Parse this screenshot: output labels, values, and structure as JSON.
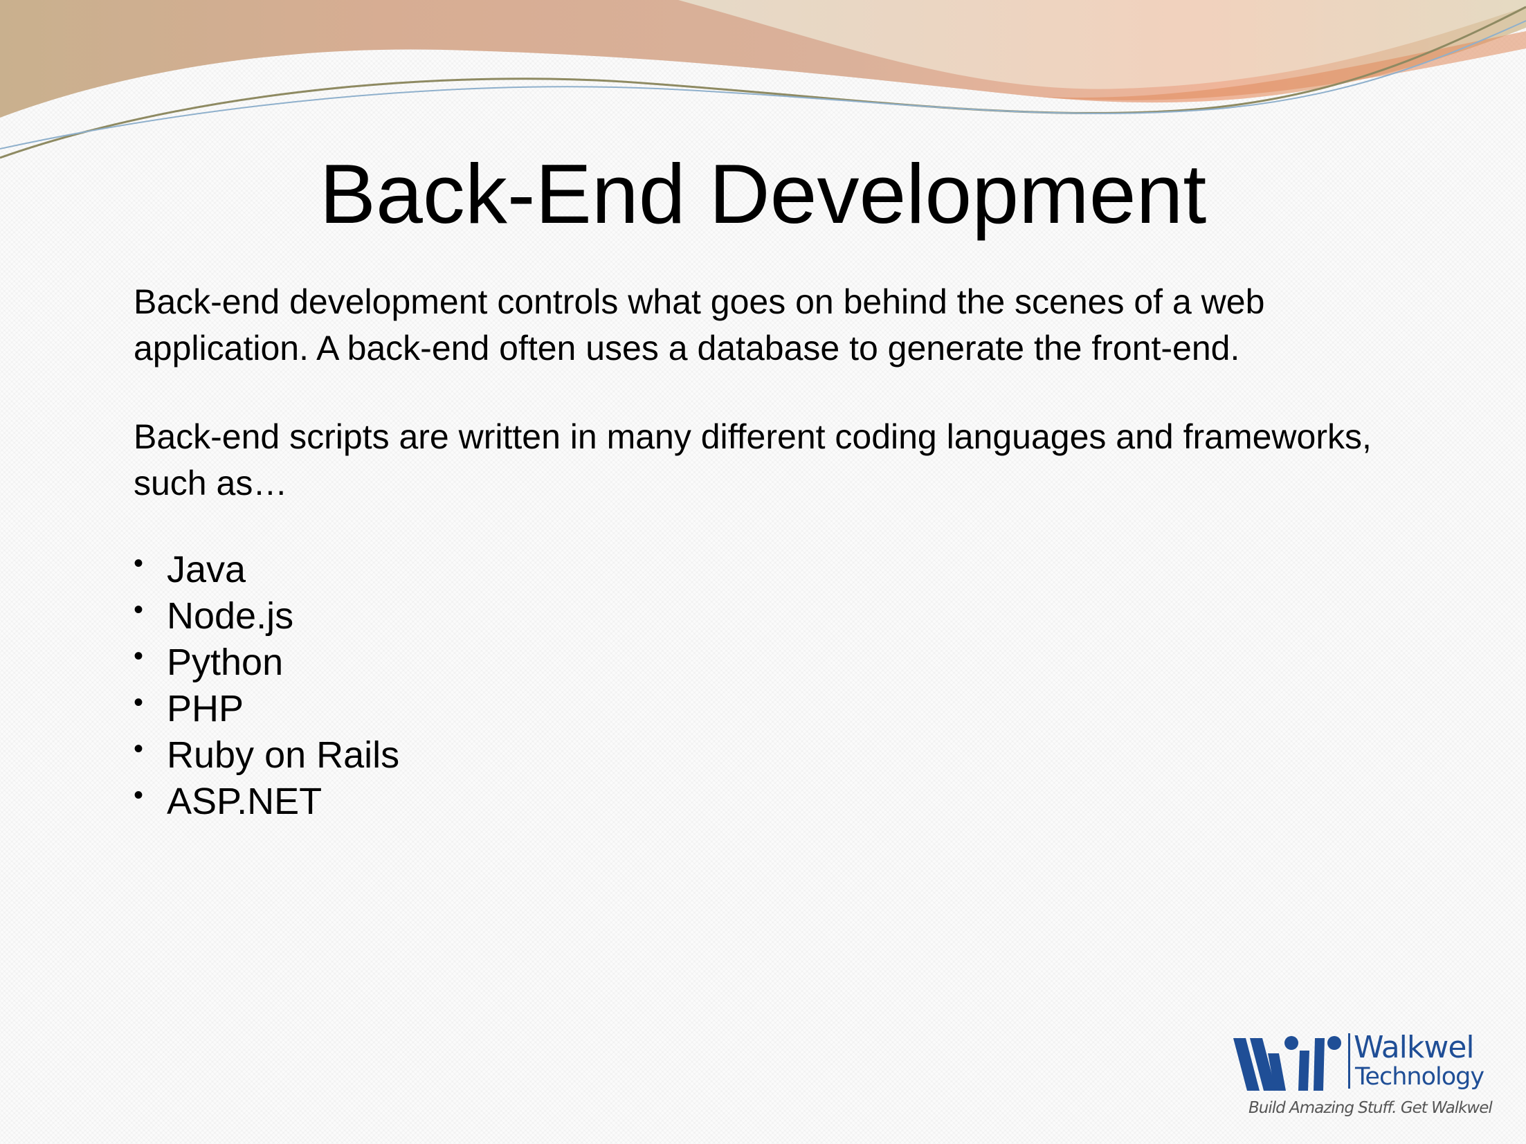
{
  "slide": {
    "title": "Back-End Development",
    "paragraphs": [
      "Back-end development controls what goes on behind the scenes of a web application. A back-end often uses a database to generate the front-end.",
      "Back-end scripts are written in many different coding languages and frameworks, such as…"
    ],
    "bullet_symbol": "•",
    "languages": [
      "Java",
      "Node.js",
      "Python",
      "PHP",
      "Ruby on Rails",
      "ASP.NET"
    ]
  },
  "logo": {
    "name": "Walkwel",
    "subtitle": "Technology",
    "tagline": "Build Amazing Stuff. Get Walkwel",
    "brand_color": "#1f4e96"
  },
  "theme": {
    "banner_colors": [
      "#d4a88c",
      "#c9b99a",
      "#f0b89c",
      "#e08a5c"
    ]
  }
}
